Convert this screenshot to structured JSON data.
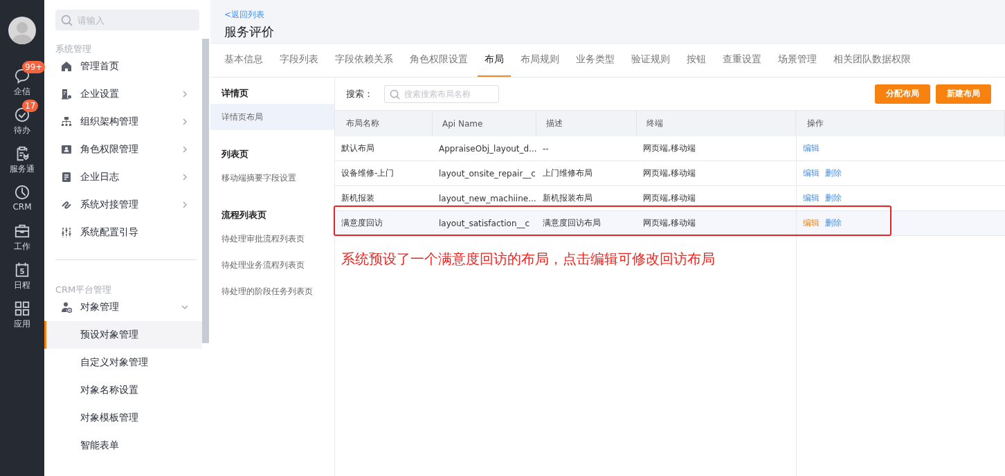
{
  "nav_rail": {
    "items": [
      {
        "kind": "chat",
        "label": "企信",
        "badge": "99+"
      },
      {
        "kind": "check",
        "label": "待办",
        "badge": "17"
      },
      {
        "kind": "service",
        "label": "服务通"
      },
      {
        "kind": "clock",
        "label": "CRM"
      },
      {
        "kind": "briefcase",
        "label": "工作"
      },
      {
        "kind": "calendar",
        "label": "日程",
        "date": "5"
      },
      {
        "kind": "apps",
        "label": "应用"
      }
    ]
  },
  "sidebar": {
    "search": {
      "placeholder": "请输入"
    },
    "sections": [
      {
        "title": "系统管理",
        "items": [
          {
            "kind": "home",
            "label": "管理首页"
          },
          {
            "kind": "building",
            "label": "企业设置",
            "expanded": false
          },
          {
            "kind": "org",
            "label": "组织架构管理",
            "expanded": false
          },
          {
            "kind": "idcard",
            "label": "角色权限管理",
            "expanded": false
          },
          {
            "kind": "doc",
            "label": "企业日志",
            "expanded": false
          },
          {
            "kind": "link",
            "label": "系统对接管理",
            "expanded": false
          },
          {
            "kind": "sliders",
            "label": "系统配置引导"
          }
        ]
      },
      {
        "title": "CRM平台管理",
        "items": [
          {
            "kind": "usergear",
            "label": "对象管理",
            "expanded": true,
            "children": [
              {
                "label": "预设对象管理",
                "selected": true
              },
              {
                "label": "自定义对象管理",
                "selected": false
              },
              {
                "label": "对象名称设置",
                "selected": false
              },
              {
                "label": "对象模板管理",
                "selected": false
              },
              {
                "label": "智能表单",
                "selected": false
              }
            ]
          }
        ]
      }
    ]
  },
  "header": {
    "back_link": "<返回列表",
    "title": "服务评价"
  },
  "tabs": [
    {
      "label": "基本信息",
      "selected": false
    },
    {
      "label": "字段列表",
      "selected": false
    },
    {
      "label": "字段依赖关系",
      "selected": false
    },
    {
      "label": "角色权限设置",
      "selected": false
    },
    {
      "label": "布局",
      "selected": true
    },
    {
      "label": "布局规则",
      "selected": false
    },
    {
      "label": "业务类型",
      "selected": false
    },
    {
      "label": "验证规则",
      "selected": false
    },
    {
      "label": "按钮",
      "selected": false
    },
    {
      "label": "查重设置",
      "selected": false
    },
    {
      "label": "场景管理",
      "selected": false
    },
    {
      "label": "相关团队数据权限",
      "selected": false
    }
  ],
  "layout_nav": {
    "groups": [
      {
        "title": "详情页",
        "items": [
          {
            "label": "详情页布局",
            "selected": true
          }
        ]
      },
      {
        "title": "列表页",
        "items": [
          {
            "label": "移动端摘要字段设置",
            "selected": false
          }
        ]
      },
      {
        "title": "流程列表页",
        "items": [
          {
            "label": "待处理审批流程列表页",
            "selected": false
          },
          {
            "label": "待处理业务流程列表页",
            "selected": false
          },
          {
            "label": "待处理的阶段任务列表页",
            "selected": false
          }
        ]
      }
    ]
  },
  "toolbar": {
    "search_label": "搜索：",
    "search_placeholder": "搜索搜索布局名称",
    "buttons": [
      "分配布局",
      "新建布局"
    ]
  },
  "table": {
    "columns": [
      "布局名称",
      "Api Name",
      "描述",
      "终端",
      "操作"
    ],
    "rows": [
      {
        "cells": [
          "默认布局",
          "AppraiseObj_layout_d...",
          "--",
          "网页端,移动端"
        ],
        "actions": [
          "编辑"
        ],
        "highlighted": false
      },
      {
        "cells": [
          "设备维修-上门",
          "layout_onsite_repair__c",
          "上门维修布局",
          "网页端,移动端"
        ],
        "actions": [
          "编辑",
          "删除"
        ],
        "highlighted": false
      },
      {
        "cells": [
          "新机报装",
          "layout_new_machiine...",
          "新机报装布局",
          "网页端,移动端"
        ],
        "actions": [
          "编辑",
          "删除"
        ],
        "highlighted": false
      },
      {
        "cells": [
          "满意度回访",
          "layout_satisfaction__c",
          "满意度回访布局",
          "网页端,移动端"
        ],
        "actions": [
          "编辑",
          "删除"
        ],
        "highlighted": true
      }
    ]
  },
  "annotation": {
    "text": "系统预设了一个满意度回访的布局，点击编辑可修改回访布局"
  }
}
